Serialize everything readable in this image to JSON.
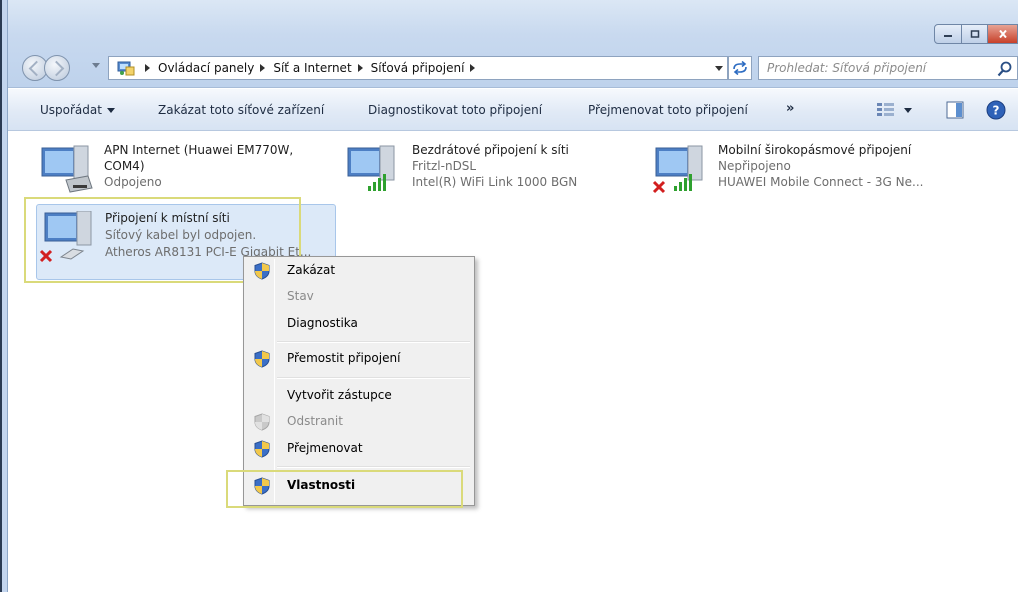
{
  "address": {
    "crumbs": [
      "Ovládací panely",
      "Síť a Internet",
      "Síťová připojení"
    ],
    "search_placeholder": "Prohledat: Síťová připojení"
  },
  "command_bar": {
    "organize": "Uspořádat",
    "disable": "Zakázat toto síťové zařízení",
    "diagnose": "Diagnostikovat toto připojení",
    "rename": "Přejmenovat toto připojení",
    "more": "»"
  },
  "connections": [
    {
      "name": "APN Internet (Huawei EM770W,",
      "name2": "COM4)",
      "status": "Odpojeno",
      "device": ""
    },
    {
      "name": "Bezdrátové připojení k síti",
      "status": "Fritzl-nDSL",
      "device": "Intel(R) WiFi Link 1000 BGN"
    },
    {
      "name": "Mobilní širokopásmové připojení",
      "status": "Nepřipojeno",
      "device": "HUAWEI Mobile Connect - 3G Ne..."
    },
    {
      "name": "Připojení k místní síti",
      "status": "Síťový kabel byl odpojen.",
      "device": "Atheros AR8131 PCI-E Gigabit Et..."
    }
  ],
  "context_menu": {
    "items": [
      "Zakázat",
      "Stav",
      "Diagnostika",
      "Přemostit připojení",
      "Vytvořit zástupce",
      "Odstranit",
      "Přejmenovat",
      "Vlastnosti"
    ]
  },
  "colors": {
    "highlight_border": "#dada7a",
    "selection": "#dce9f8",
    "command_text": "#1e2c42"
  }
}
